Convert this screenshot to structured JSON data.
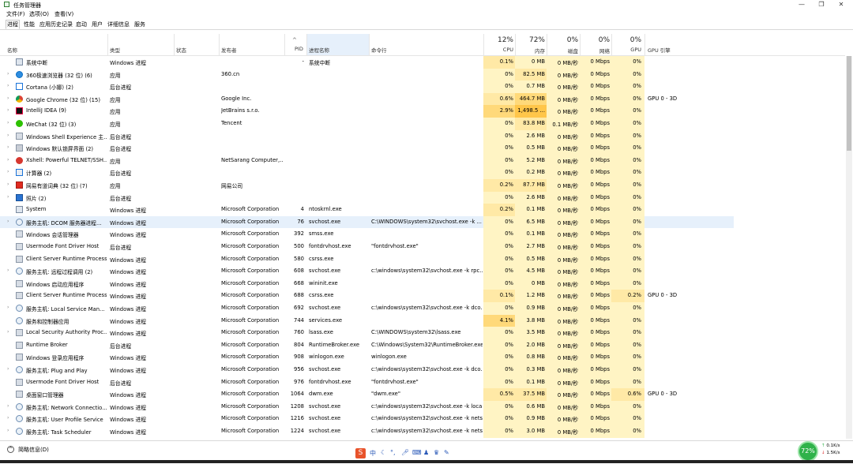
{
  "window": {
    "title": "任务管理器",
    "controls": [
      "—",
      "❐",
      "✕"
    ]
  },
  "menu": [
    "文件(F)",
    "选项(O)",
    "查看(V)"
  ],
  "tabs": [
    {
      "label": "进程",
      "active": true
    },
    {
      "label": "性能"
    },
    {
      "label": "应用历史记录"
    },
    {
      "label": "启动"
    },
    {
      "label": "用户"
    },
    {
      "label": "详细信息"
    },
    {
      "label": "服务"
    }
  ],
  "columns": {
    "name": "名称",
    "type": "类型",
    "status": "状态",
    "publisher": "发布者",
    "pid": "PID",
    "process_name": "进程名称",
    "command_line": "命令行",
    "cpu": {
      "pct": "12%",
      "label": "CPU"
    },
    "memory": {
      "pct": "72%",
      "label": "内存"
    },
    "disk": {
      "pct": "0%",
      "label": "磁盘"
    },
    "network": {
      "pct": "0%",
      "label": "网络"
    },
    "gpu": {
      "pct": "0%",
      "label": "GPU"
    },
    "gpu_engine": "GPU 引擎"
  },
  "rows": [
    {
      "name": "系统中断",
      "type": "Windows 进程",
      "publisher": "",
      "pid": "-",
      "proc": "系统中断",
      "cmd": "",
      "cpu": "0.1%",
      "mem": "0 MB",
      "disk": "0 MB/秒",
      "net": "0 Mbps",
      "gpu": "0%",
      "eng": "",
      "expand": false,
      "icon": "system-icon",
      "heat": 1,
      "memheat": 0
    },
    {
      "name": "360极速浏览器 (32 位) (6)",
      "type": "应用",
      "publisher": "360.cn",
      "pid": "",
      "proc": "",
      "cmd": "",
      "cpu": "0%",
      "mem": "82.5 MB",
      "disk": "0 MB/秒",
      "net": "0 Mbps",
      "gpu": "0%",
      "eng": "",
      "expand": true,
      "icon": "browser-360-icon",
      "heat": 0,
      "memheat": 1
    },
    {
      "name": "Cortana (小娜) (2)",
      "type": "后台进程",
      "publisher": "",
      "pid": "",
      "proc": "",
      "cmd": "",
      "cpu": "0%",
      "mem": "0.7 MB",
      "disk": "0 MB/秒",
      "net": "0 Mbps",
      "gpu": "0%",
      "eng": "",
      "expand": true,
      "icon": "cortana-icon",
      "heat": 0,
      "memheat": 0
    },
    {
      "name": "Google Chrome (32 位) (15)",
      "type": "应用",
      "publisher": "Google Inc.",
      "pid": "",
      "proc": "",
      "cmd": "",
      "cpu": "0.6%",
      "mem": "464.7 MB",
      "disk": "0 MB/秒",
      "net": "0 Mbps",
      "gpu": "0%",
      "eng": "GPU 0 - 3D",
      "expand": true,
      "icon": "chrome-icon",
      "heat": 1,
      "memheat": 2
    },
    {
      "name": "IntelliJ IDEA (9)",
      "type": "应用",
      "publisher": "JetBrains s.r.o.",
      "pid": "",
      "proc": "",
      "cmd": "",
      "cpu": "2.9%",
      "mem": "1,498.5 ...",
      "disk": "0 MB/秒",
      "net": "0 Mbps",
      "gpu": "0%",
      "eng": "",
      "expand": true,
      "icon": "intellij-icon",
      "heat": 2,
      "memheat": 3
    },
    {
      "name": "WeChat (32 位) (3)",
      "type": "应用",
      "publisher": "Tencent",
      "pid": "",
      "proc": "",
      "cmd": "",
      "cpu": "0%",
      "mem": "83.8 MB",
      "disk": "0.1 MB/秒",
      "net": "0 Mbps",
      "gpu": "0%",
      "eng": "",
      "expand": true,
      "icon": "wechat-icon",
      "heat": 0,
      "memheat": 1
    },
    {
      "name": "Windows Shell Experience 主...",
      "type": "后台进程",
      "publisher": "",
      "pid": "",
      "proc": "",
      "cmd": "",
      "cpu": "0%",
      "mem": "2.6 MB",
      "disk": "0 MB/秒",
      "net": "0 Mbps",
      "gpu": "0%",
      "eng": "",
      "expand": true,
      "icon": "window-icon",
      "heat": 0,
      "memheat": 0
    },
    {
      "name": "Windows 默认锁屏界面 (2)",
      "type": "后台进程",
      "publisher": "",
      "pid": "",
      "proc": "",
      "cmd": "",
      "cpu": "0%",
      "mem": "0.5 MB",
      "disk": "0 MB/秒",
      "net": "0 Mbps",
      "gpu": "0%",
      "eng": "",
      "expand": true,
      "icon": "lockscreen-icon",
      "heat": 0,
      "memheat": 0
    },
    {
      "name": "Xshell: Powerful TELNET/SSH...",
      "type": "应用",
      "publisher": "NetSarang Computer,...",
      "pid": "",
      "proc": "",
      "cmd": "",
      "cpu": "0%",
      "mem": "5.2 MB",
      "disk": "0 MB/秒",
      "net": "0 Mbps",
      "gpu": "0%",
      "eng": "",
      "expand": true,
      "icon": "xshell-icon",
      "heat": 0,
      "memheat": 0
    },
    {
      "name": "计算器 (2)",
      "type": "后台进程",
      "publisher": "",
      "pid": "",
      "proc": "",
      "cmd": "",
      "cpu": "0%",
      "mem": "0.2 MB",
      "disk": "0 MB/秒",
      "net": "0 Mbps",
      "gpu": "0%",
      "eng": "",
      "expand": true,
      "icon": "calculator-icon",
      "heat": 0,
      "memheat": 0
    },
    {
      "name": "网易有道词典 (32 位) (7)",
      "type": "应用",
      "publisher": "网易公司",
      "pid": "",
      "proc": "",
      "cmd": "",
      "cpu": "0.2%",
      "mem": "87.7 MB",
      "disk": "0 MB/秒",
      "net": "0 Mbps",
      "gpu": "0%",
      "eng": "",
      "expand": true,
      "icon": "youdao-icon",
      "heat": 1,
      "memheat": 1
    },
    {
      "name": "照片 (2)",
      "type": "后台进程",
      "publisher": "",
      "pid": "",
      "proc": "",
      "cmd": "",
      "cpu": "0%",
      "mem": "2.6 MB",
      "disk": "0 MB/秒",
      "net": "0 Mbps",
      "gpu": "0%",
      "eng": "",
      "expand": true,
      "icon": "photos-icon",
      "heat": 0,
      "memheat": 0
    },
    {
      "name": "System",
      "type": "Windows 进程",
      "publisher": "Microsoft Corporation",
      "pid": "4",
      "proc": "ntoskrnl.exe",
      "cmd": "",
      "cpu": "0.2%",
      "mem": "0.1 MB",
      "disk": "0 MB/秒",
      "net": "0 Mbps",
      "gpu": "0%",
      "eng": "",
      "expand": false,
      "icon": "system-icon",
      "heat": 1,
      "memheat": 0
    },
    {
      "name": "服务主机: DCOM 服务器进程...",
      "type": "Windows 进程",
      "publisher": "Microsoft Corporation",
      "pid": "76",
      "proc": "svchost.exe",
      "cmd": "C:\\WINDOWS\\system32\\svchost.exe -k ...",
      "cpu": "0%",
      "mem": "6.5 MB",
      "disk": "0 MB/秒",
      "net": "0 Mbps",
      "gpu": "0%",
      "eng": "",
      "expand": true,
      "icon": "service-gear-icon",
      "heat": 0,
      "memheat": 0,
      "selected": true
    },
    {
      "name": "Windows 会话管理器",
      "type": "Windows 进程",
      "publisher": "Microsoft Corporation",
      "pid": "392",
      "proc": "smss.exe",
      "cmd": "",
      "cpu": "0%",
      "mem": "0.1 MB",
      "disk": "0 MB/秒",
      "net": "0 Mbps",
      "gpu": "0%",
      "eng": "",
      "expand": false,
      "icon": "window-icon",
      "heat": 0,
      "memheat": 0
    },
    {
      "name": "Usermode Font Driver Host",
      "type": "后台进程",
      "publisher": "Microsoft Corporation",
      "pid": "500",
      "proc": "fontdrvhost.exe",
      "cmd": "\"fontdrvhost.exe\"",
      "cpu": "0%",
      "mem": "2.7 MB",
      "disk": "0 MB/秒",
      "net": "0 Mbps",
      "gpu": "0%",
      "eng": "",
      "expand": false,
      "icon": "window-icon",
      "heat": 0,
      "memheat": 0
    },
    {
      "name": "Client Server Runtime Process",
      "type": "Windows 进程",
      "publisher": "Microsoft Corporation",
      "pid": "580",
      "proc": "csrss.exe",
      "cmd": "",
      "cpu": "0%",
      "mem": "0.5 MB",
      "disk": "0 MB/秒",
      "net": "0 Mbps",
      "gpu": "0%",
      "eng": "",
      "expand": false,
      "icon": "window-icon",
      "heat": 0,
      "memheat": 0
    },
    {
      "name": "服务主机: 远程过程调用 (2)",
      "type": "Windows 进程",
      "publisher": "Microsoft Corporation",
      "pid": "608",
      "proc": "svchost.exe",
      "cmd": "c:\\windows\\system32\\svchost.exe -k rpc...",
      "cpu": "0%",
      "mem": "4.5 MB",
      "disk": "0 MB/秒",
      "net": "0 Mbps",
      "gpu": "0%",
      "eng": "",
      "expand": true,
      "icon": "service-gear-icon",
      "heat": 0,
      "memheat": 0
    },
    {
      "name": "Windows 启动应用程序",
      "type": "Windows 进程",
      "publisher": "Microsoft Corporation",
      "pid": "668",
      "proc": "wininit.exe",
      "cmd": "",
      "cpu": "0%",
      "mem": "0 MB",
      "disk": "0 MB/秒",
      "net": "0 Mbps",
      "gpu": "0%",
      "eng": "",
      "expand": false,
      "icon": "window-icon",
      "heat": 0,
      "memheat": 0
    },
    {
      "name": "Client Server Runtime Process",
      "type": "Windows 进程",
      "publisher": "Microsoft Corporation",
      "pid": "688",
      "proc": "csrss.exe",
      "cmd": "",
      "cpu": "0.1%",
      "mem": "1.2 MB",
      "disk": "0 MB/秒",
      "net": "0 Mbps",
      "gpu": "0.2%",
      "eng": "GPU 0 - 3D",
      "expand": false,
      "icon": "window-icon",
      "heat": 1,
      "memheat": 0,
      "gpuheat": 1
    },
    {
      "name": "服务主机: Local Service Man...",
      "type": "Windows 进程",
      "publisher": "Microsoft Corporation",
      "pid": "692",
      "proc": "svchost.exe",
      "cmd": "c:\\windows\\system32\\svchost.exe -k dco...",
      "cpu": "0%",
      "mem": "0.9 MB",
      "disk": "0 MB/秒",
      "net": "0 Mbps",
      "gpu": "0%",
      "eng": "",
      "expand": true,
      "icon": "service-gear-icon",
      "heat": 0,
      "memheat": 0
    },
    {
      "name": "服务和控制器应用",
      "type": "Windows 进程",
      "publisher": "Microsoft Corporation",
      "pid": "744",
      "proc": "services.exe",
      "cmd": "",
      "cpu": "4.1%",
      "mem": "3.8 MB",
      "disk": "0 MB/秒",
      "net": "0 Mbps",
      "gpu": "0%",
      "eng": "",
      "expand": false,
      "icon": "service-gear-icon",
      "heat": 2,
      "memheat": 0
    },
    {
      "name": "Local Security Authority Proc...",
      "type": "Windows 进程",
      "publisher": "Microsoft Corporation",
      "pid": "760",
      "proc": "lsass.exe",
      "cmd": "C:\\WINDOWS\\system32\\lsass.exe",
      "cpu": "0%",
      "mem": "3.5 MB",
      "disk": "0 MB/秒",
      "net": "0 Mbps",
      "gpu": "0%",
      "eng": "",
      "expand": true,
      "icon": "window-icon",
      "heat": 0,
      "memheat": 0
    },
    {
      "name": "Runtime Broker",
      "type": "后台进程",
      "publisher": "Microsoft Corporation",
      "pid": "804",
      "proc": "RuntimeBroker.exe",
      "cmd": "C:\\Windows\\System32\\RuntimeBroker.exe...",
      "cpu": "0%",
      "mem": "2.0 MB",
      "disk": "0 MB/秒",
      "net": "0 Mbps",
      "gpu": "0%",
      "eng": "",
      "expand": false,
      "icon": "window-icon",
      "heat": 0,
      "memheat": 0
    },
    {
      "name": "Windows 登录应用程序",
      "type": "Windows 进程",
      "publisher": "Microsoft Corporation",
      "pid": "908",
      "proc": "winlogon.exe",
      "cmd": "winlogon.exe",
      "cpu": "0%",
      "mem": "0.8 MB",
      "disk": "0 MB/秒",
      "net": "0 Mbps",
      "gpu": "0%",
      "eng": "",
      "expand": false,
      "icon": "window-icon",
      "heat": 0,
      "memheat": 0
    },
    {
      "name": "服务主机: Plug and Play",
      "type": "Windows 进程",
      "publisher": "Microsoft Corporation",
      "pid": "956",
      "proc": "svchost.exe",
      "cmd": "c:\\windows\\system32\\svchost.exe -k dco...",
      "cpu": "0%",
      "mem": "0.3 MB",
      "disk": "0 MB/秒",
      "net": "0 Mbps",
      "gpu": "0%",
      "eng": "",
      "expand": true,
      "icon": "service-gear-icon",
      "heat": 0,
      "memheat": 0
    },
    {
      "name": "Usermode Font Driver Host",
      "type": "后台进程",
      "publisher": "Microsoft Corporation",
      "pid": "976",
      "proc": "fontdrvhost.exe",
      "cmd": "\"fontdrvhost.exe\"",
      "cpu": "0%",
      "mem": "0.1 MB",
      "disk": "0 MB/秒",
      "net": "0 Mbps",
      "gpu": "0%",
      "eng": "",
      "expand": false,
      "icon": "window-icon",
      "heat": 0,
      "memheat": 0
    },
    {
      "name": "桌面窗口管理器",
      "type": "Windows 进程",
      "publisher": "Microsoft Corporation",
      "pid": "1064",
      "proc": "dwm.exe",
      "cmd": "\"dwm.exe\"",
      "cpu": "0.5%",
      "mem": "37.5 MB",
      "disk": "0 MB/秒",
      "net": "0 Mbps",
      "gpu": "0.6%",
      "eng": "GPU 0 - 3D",
      "expand": false,
      "icon": "window-icon",
      "heat": 1,
      "memheat": 1,
      "gpuheat": 1
    },
    {
      "name": "服务主机: Network Connectio...",
      "type": "Windows 进程",
      "publisher": "Microsoft Corporation",
      "pid": "1208",
      "proc": "svchost.exe",
      "cmd": "c:\\windows\\system32\\svchost.exe -k loca...",
      "cpu": "0%",
      "mem": "0.6 MB",
      "disk": "0 MB/秒",
      "net": "0 Mbps",
      "gpu": "0%",
      "eng": "",
      "expand": true,
      "icon": "service-gear-icon",
      "heat": 0,
      "memheat": 0
    },
    {
      "name": "服务主机: User Profile Service",
      "type": "Windows 进程",
      "publisher": "Microsoft Corporation",
      "pid": "1216",
      "proc": "svchost.exe",
      "cmd": "c:\\windows\\system32\\svchost.exe -k nets...",
      "cpu": "0%",
      "mem": "0.9 MB",
      "disk": "0 MB/秒",
      "net": "0 Mbps",
      "gpu": "0%",
      "eng": "",
      "expand": true,
      "icon": "service-gear-icon",
      "heat": 0,
      "memheat": 0
    },
    {
      "name": "服务主机: Task Scheduler",
      "type": "Windows 进程",
      "publisher": "Microsoft Corporation",
      "pid": "1224",
      "proc": "svchost.exe",
      "cmd": "c:\\windows\\system32\\svchost.exe -k nets...",
      "cpu": "0%",
      "mem": "3.0 MB",
      "disk": "0 MB/秒",
      "net": "0 Mbps",
      "gpu": "0%",
      "eng": "",
      "expand": true,
      "icon": "service-gear-icon",
      "heat": 0,
      "memheat": 0
    }
  ],
  "footer": {
    "less_details": "简略信息(D)"
  },
  "tray": {
    "ime": "中",
    "network_usage": "72%",
    "up": "0.1K/s",
    "down": "1.5K/s"
  },
  "colors": {
    "heat0": "#fff4c4",
    "heat1": "#ffe9a6",
    "heat2": "#ffd97a",
    "heat3": "#ffc64a",
    "selected": "#e6f0fb",
    "accent": "#0078d7"
  }
}
